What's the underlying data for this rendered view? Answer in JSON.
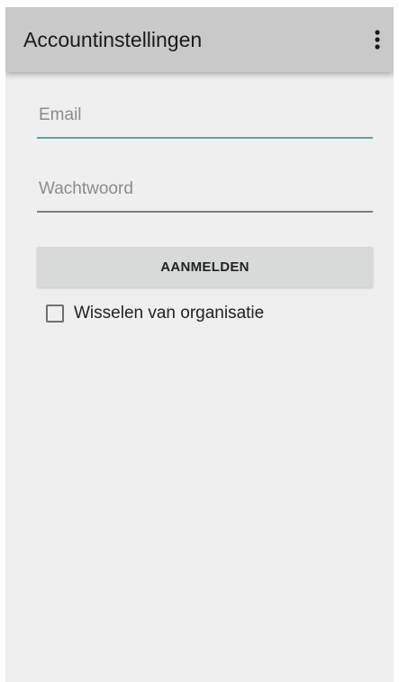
{
  "app_bar": {
    "title": "Accountinstellingen",
    "overflow_icon": "more-vertical-icon"
  },
  "form": {
    "email": {
      "placeholder": "Email",
      "value": ""
    },
    "password": {
      "placeholder": "Wachtwoord",
      "value": ""
    },
    "login_button_label": "AANMELDEN",
    "switch_org": {
      "label": "Wisselen van organisatie",
      "checked": false
    }
  },
  "colors": {
    "app_bar_bg": "#c9c9c9",
    "screen_bg": "#efefef",
    "email_underline_accent": "#5aa5a0",
    "button_bg": "#d8d9d9"
  }
}
